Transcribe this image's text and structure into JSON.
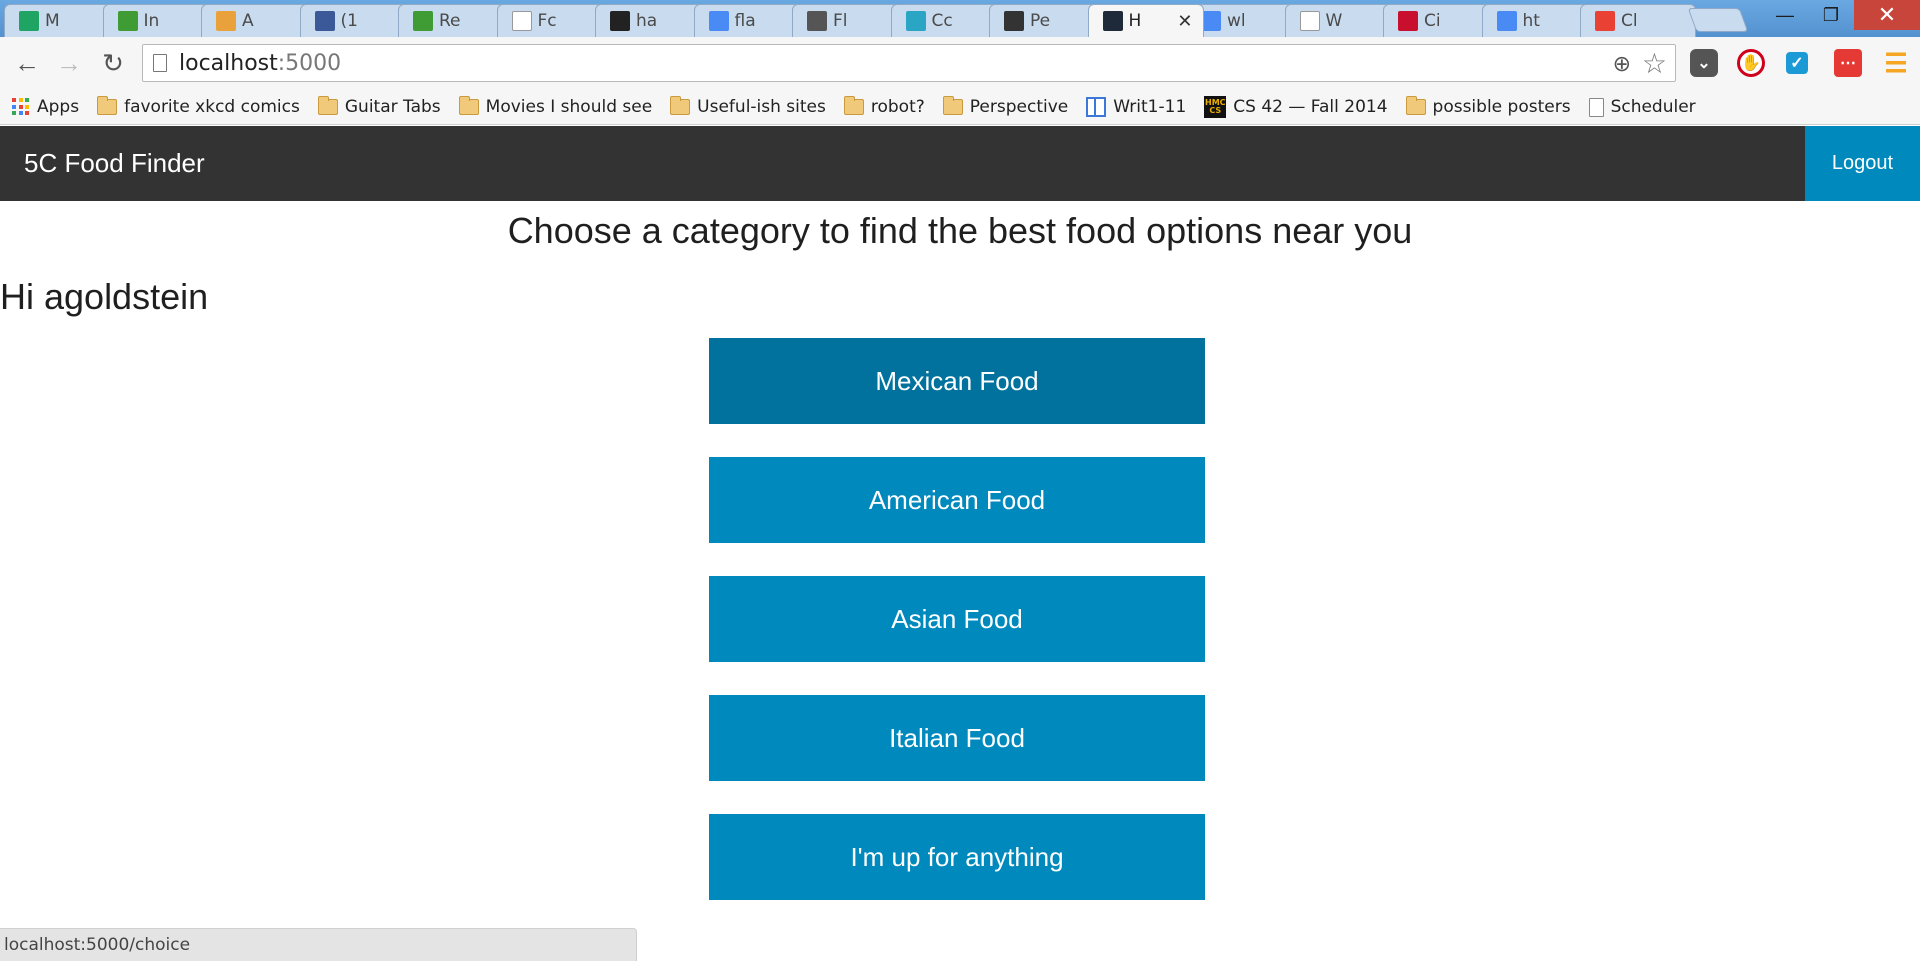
{
  "browser": {
    "tabs": [
      {
        "label": "M",
        "icon": "google-drive-icon",
        "color": "#1fa463"
      },
      {
        "label": "In",
        "icon": "mongodb-leaf-icon",
        "color": "#3f9c35"
      },
      {
        "label": "A",
        "icon": "analytics-bars-icon",
        "color": "#e9a23b"
      },
      {
        "label": "(1",
        "icon": "facebook-icon",
        "color": "#3b5998"
      },
      {
        "label": "Re",
        "icon": "mongodb-leaf-icon",
        "color": "#3f9c35"
      },
      {
        "label": "Fc",
        "icon": "blank-page-icon",
        "color": "#ffffff"
      },
      {
        "label": "ha",
        "icon": "github-icon",
        "color": "#222222"
      },
      {
        "label": "fla",
        "icon": "google-search-icon",
        "color": "#4a8af4"
      },
      {
        "label": "Fl",
        "icon": "docs-panel-icon",
        "color": "#555555"
      },
      {
        "label": "Cc",
        "icon": "flask-f-icon",
        "color": "#2aa5c4"
      },
      {
        "label": "Pe",
        "icon": "gear-icon",
        "color": "#333333"
      },
      {
        "label": "H",
        "icon": "terminal-icon",
        "color": "#1e2a3a",
        "active": true
      },
      {
        "label": "wl",
        "icon": "google-search-icon",
        "color": "#4a8af4"
      },
      {
        "label": "W",
        "icon": "blank-page-icon",
        "color": "#ffffff"
      },
      {
        "label": "Ci",
        "icon": "cisco-icon",
        "color": "#c8102e"
      },
      {
        "label": "ht",
        "icon": "google-search-icon",
        "color": "#4a8af4"
      },
      {
        "label": "Cl",
        "icon": "pinwheel-icon",
        "color": "#e94235"
      }
    ],
    "url": {
      "host": "localhost",
      "port": ":5000"
    },
    "bookmarks": [
      {
        "label": "Apps",
        "icon": "apps-grid-icon"
      },
      {
        "label": "favorite xkcd comics",
        "icon": "folder-icon"
      },
      {
        "label": "Guitar Tabs",
        "icon": "folder-icon"
      },
      {
        "label": "Movies I should see",
        "icon": "folder-icon"
      },
      {
        "label": "Useful-ish sites",
        "icon": "folder-icon"
      },
      {
        "label": "robot?",
        "icon": "folder-icon"
      },
      {
        "label": "Perspective",
        "icon": "folder-icon"
      },
      {
        "label": "Writ1-11",
        "icon": "writ-doc-icon"
      },
      {
        "label": "CS 42 — Fall 2014",
        "icon": "hmc-cs-icon"
      },
      {
        "label": "possible posters",
        "icon": "folder-icon"
      },
      {
        "label": "Scheduler",
        "icon": "blank-page-icon"
      }
    ],
    "status_url": "localhost:5000/choice"
  },
  "app": {
    "brand": "5C Food Finder",
    "logout_label": "Logout",
    "headline": "Choose a category to find the best food options near you",
    "greeting": "Hi agoldstein",
    "categories": [
      {
        "label": "Mexican Food",
        "hovered": true
      },
      {
        "label": "American Food"
      },
      {
        "label": "Asian Food"
      },
      {
        "label": "Italian Food"
      },
      {
        "label": "I'm up for anything"
      }
    ],
    "colors": {
      "navbar": "#333333",
      "accent": "#0089bd",
      "accent_hover": "#00729d"
    }
  }
}
